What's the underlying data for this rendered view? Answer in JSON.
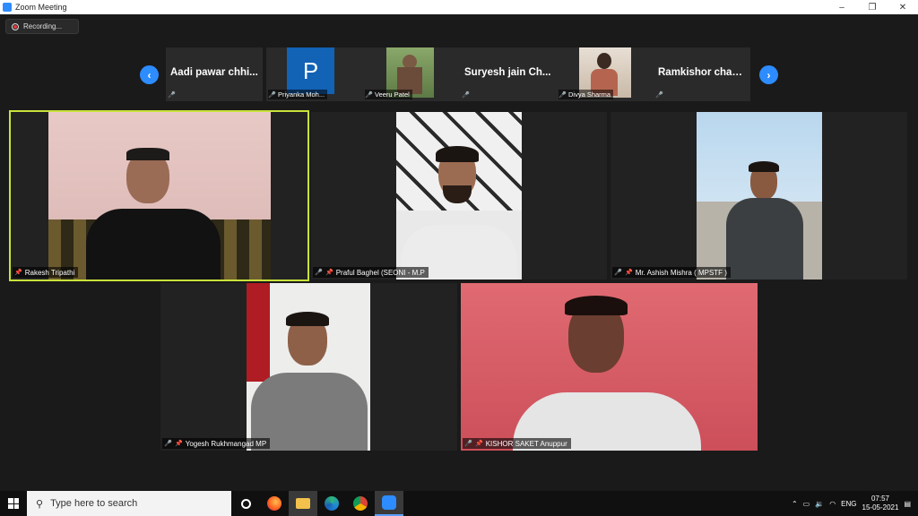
{
  "window": {
    "title": "Zoom Meeting",
    "minimize": "–",
    "restore": "❐",
    "close": "✕"
  },
  "recording": {
    "label": "Recording..."
  },
  "strip": {
    "prev": "‹",
    "next": "›",
    "thumbs": [
      {
        "name": "Aadi pawar chhi...",
        "type": "name"
      },
      {
        "name": "Priyanka Moh...",
        "type": "avatar",
        "initial": "P"
      },
      {
        "name": "Veeru Patel",
        "type": "video"
      },
      {
        "name": "Suryesh jain Ch...",
        "type": "name"
      },
      {
        "name": "Divya Sharma",
        "type": "video"
      },
      {
        "name": "Ramkishor chau...",
        "type": "name"
      }
    ]
  },
  "tiles": [
    {
      "name": "Rakesh Tripathi"
    },
    {
      "name": "Praful Baghel (SEONI - M.P"
    },
    {
      "name": "Mr. Ashish Mishra ( MPSTF )"
    },
    {
      "name": "Yogesh Rukhmangad MP"
    },
    {
      "name": "KISHOR SAKET Anuppur"
    }
  ],
  "taskbar": {
    "search_placeholder": "Type here to search",
    "lang": "ENG",
    "time": "07:57",
    "date": "15-05-2021"
  }
}
